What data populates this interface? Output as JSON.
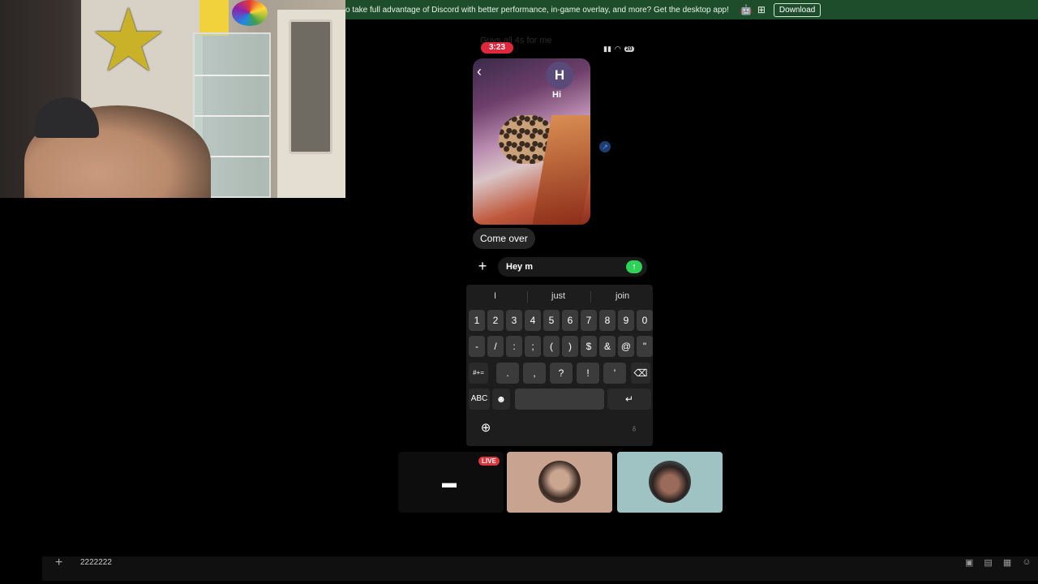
{
  "banner": {
    "text": "o take full advantage of Discord with better performance, in-game overlay, and more? Get the desktop app!",
    "download_label": "Download",
    "os_icons": [
      "apple-icon",
      "android-icon",
      "windows-icon"
    ]
  },
  "phone": {
    "time": "3:23",
    "battery": "20",
    "ghost_text": "Guys all 4s for me",
    "avatar_letter": "H",
    "story_caption": "Hi",
    "message_bubble": "Come over",
    "input_value": "Hey m",
    "send_icon": "arrow-up",
    "keyboard": {
      "suggestions": [
        "I",
        "just",
        "join"
      ],
      "row1": [
        "1",
        "2",
        "3",
        "4",
        "5",
        "6",
        "7",
        "8",
        "9",
        "0"
      ],
      "row2": [
        "-",
        "/",
        ":",
        ";",
        "(",
        ")",
        "$",
        "&",
        "@",
        "\""
      ],
      "row3": [
        "#+=",
        ".",
        ",",
        "?",
        "!",
        "'",
        "⌫"
      ],
      "row4_abc": "ABC",
      "row4_return": "↵"
    }
  },
  "call": {
    "live_badge": "LIVE",
    "tiles": [
      "screen-share",
      "participant",
      "participant"
    ]
  },
  "chat": {
    "input_value": "2222222"
  },
  "colors": {
    "banner_bg": "#1e4d2b",
    "live_red": "#da373c",
    "send_green": "#2fd159",
    "time_pill": "#e0283c"
  }
}
